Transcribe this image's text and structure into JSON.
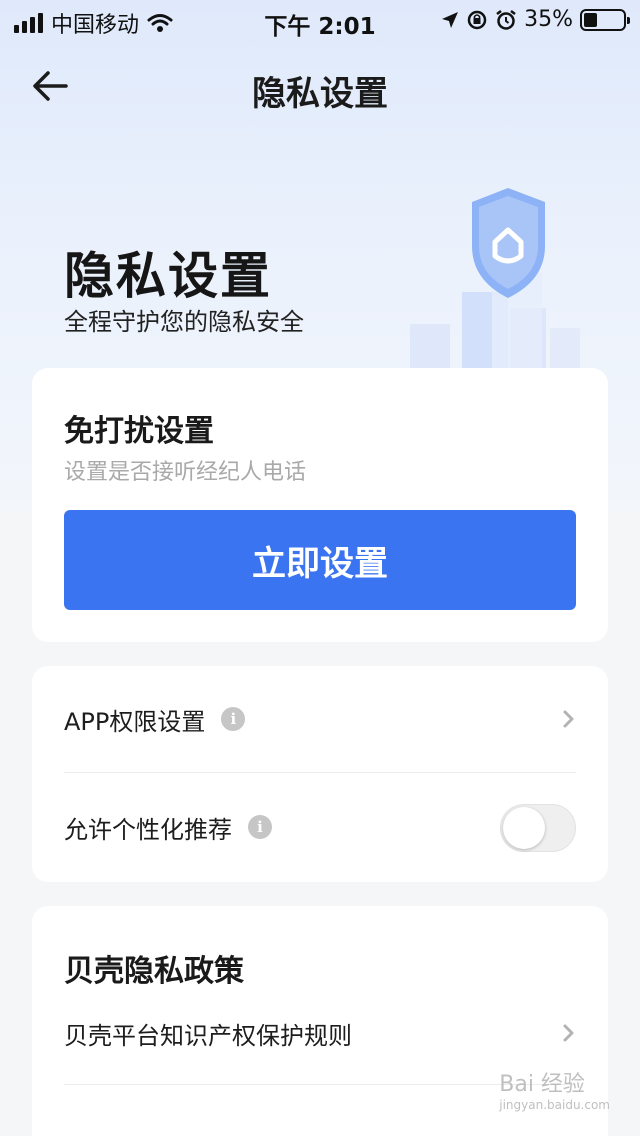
{
  "status_bar": {
    "carrier": "中国移动",
    "time": "下午 2:01",
    "battery": "35%",
    "battery_level": 0.35
  },
  "nav": {
    "back_icon": "arrow-left-icon",
    "title": "隐私设置"
  },
  "hero": {
    "title": "隐私设置",
    "subtitle": "全程守护您的隐私安全"
  },
  "dnd_card": {
    "title": "免打扰设置",
    "description": "设置是否接听经纪人电话",
    "button_label": "立即设置",
    "accent_color": "#3b74f0"
  },
  "settings": {
    "app_permissions": {
      "label": "APP权限设置"
    },
    "personalized": {
      "label": "允许个性化推荐",
      "enabled": false
    }
  },
  "policy": {
    "title": "贝壳隐私政策",
    "items": [
      {
        "label": "贝壳平台知识产权保护规则"
      }
    ]
  },
  "watermark": {
    "text": "Bai 经验",
    "sub": "jingyan.baidu.com"
  }
}
